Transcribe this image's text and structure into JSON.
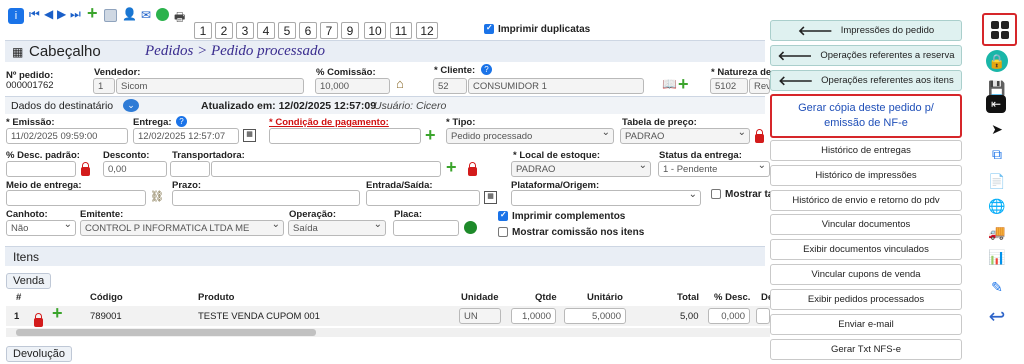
{
  "toolbar": {
    "pages": [
      "1",
      "2",
      "3",
      "4",
      "5",
      "6",
      "7",
      "9",
      "10",
      "11",
      "12"
    ],
    "print_duplicates_label": "Imprimir duplicatas"
  },
  "header": {
    "section_title": "Cabeçalho",
    "breadcrumb": "Pedidos > Pedido processado"
  },
  "order": {
    "number_label": "Nº pedido:",
    "number_value": "000001762",
    "seller_label": "Vendedor:",
    "seller_code": "1",
    "seller_name": "Sicom",
    "commission_label": "% Comissão:",
    "commission_value": "10,000",
    "client_label": "* Cliente:",
    "client_code": "52",
    "client_name": "CONSUMIDOR 1",
    "nature_label": "* Natureza de",
    "nature_code": "5102",
    "nature_name": "Rev"
  },
  "recipient": {
    "title": "Dados do destinatário",
    "updated_at": "Atualizado em: 12/02/2025 12:57:09",
    "user": "Usuário: Cicero"
  },
  "fields": {
    "emission_label": "* Emissão:",
    "emission_value": "11/02/2025 09:59:00",
    "delivery_label": "Entrega:",
    "delivery_value": "12/02/2025 12:57:07",
    "payment_label": "* Condição de pagamento:",
    "type_label": "* Tipo:",
    "type_value": "Pedido processado",
    "price_table_label": "Tabela de preço:",
    "price_table_value": "PADRAO",
    "discount_std_label": "% Desc. padrão:",
    "discount_label": "Desconto:",
    "discount_value": "0,00",
    "carrier_label": "Transportadora:",
    "stock_label": "* Local de estoque:",
    "stock_value": "PADRAO",
    "delivery_status_label": "Status da entrega:",
    "delivery_status_value": "1 - Pendente",
    "delivery_mode_label": "Meio de entrega:",
    "deadline_label": "Prazo:",
    "entry_exit_label": "Entrada/Saída:",
    "platform_label": "Plataforma/Origem:",
    "show_label": "Mostrar ta",
    "stub_label": "Canhoto:",
    "stub_value": "Não",
    "issuer_label": "Emitente:",
    "issuer_value": "CONTROL P INFORMATICA LTDA ME",
    "operation_label": "Operação:",
    "operation_value": "Saída",
    "plate_label": "Placa:",
    "print_complements": "Imprimir complementos",
    "show_commission": "Mostrar comissão nos itens"
  },
  "items": {
    "title": "Itens",
    "sale_tab": "Venda",
    "return_tab": "Devolução",
    "columns": [
      "#",
      "Código",
      "Produto",
      "Unidade",
      "Qtde",
      "Unitário",
      "Total",
      "% Desc.",
      "De"
    ],
    "row": {
      "n": "1",
      "code": "789001",
      "product": "TESTE VENDA CUPOM 001",
      "unit": "UN",
      "qty": "1,0000",
      "unit_price": "5,0000",
      "total": "5,00",
      "disc": "0,000"
    }
  },
  "menu": {
    "nav": [
      "Impressões do pedido",
      "Operações referentes a reserva",
      "Operações referentes aos itens"
    ],
    "highlight": "Gerar cópia deste pedido p/ emissão de NF-e",
    "actions": [
      "Histórico de entregas",
      "Histórico de impressões",
      "Histórico de envio e retorno do pdv",
      "Vincular documentos",
      "Exibir documentos vinculados",
      "Vincular cupons de venda",
      "Exibir pedidos processados",
      "Enviar e-mail",
      "Gerar Txt NFS-e"
    ]
  },
  "colors": {
    "accent": "#1a73e8",
    "highlight_border": "#d6262a",
    "nav_bg": "#dff1f0",
    "breadcrumb": "#3a2d8f"
  }
}
